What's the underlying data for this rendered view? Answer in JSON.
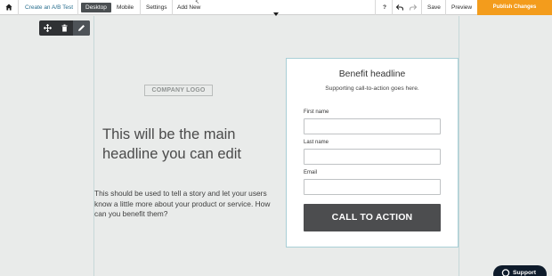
{
  "toolbar": {
    "ab_test_label": "Create an A/B Test",
    "desktop_label": "Desktop",
    "mobile_label": "Mobile",
    "settings_label": "Settings",
    "add_new_label": "Add New",
    "help_label": "?",
    "save_label": "Save",
    "preview_label": "Preview",
    "publish_label": "Publish Changes",
    "active_tab": "Desktop"
  },
  "icons": {
    "home": "home-icon",
    "undo": "undo-icon",
    "redo": "redo-icon",
    "move": "move-icon",
    "delete": "trash-icon",
    "edit": "pencil-icon",
    "support": "chat-icon"
  },
  "page": {
    "logo_placeholder": "COMPANY LOGO",
    "headline": "This will be the main headline you can edit",
    "body": "This should be used to tell a story and let your users know a little more about your product or service. How can you benefit them?"
  },
  "form": {
    "title": "Benefit headline",
    "subtitle": "Supporting call-to-action goes here.",
    "fields": [
      {
        "label": "First name",
        "value": ""
      },
      {
        "label": "Last name",
        "value": ""
      },
      {
        "label": "Email",
        "value": ""
      }
    ],
    "cta_label": "CALL TO ACTION"
  },
  "support": {
    "label": "Support"
  },
  "colors": {
    "publish_accent": "#f39c1c",
    "link": "#2a6f8f",
    "cta_background": "#4c4d4f",
    "support_background": "#0e1b2b",
    "canvas_background": "#e9ebea"
  }
}
